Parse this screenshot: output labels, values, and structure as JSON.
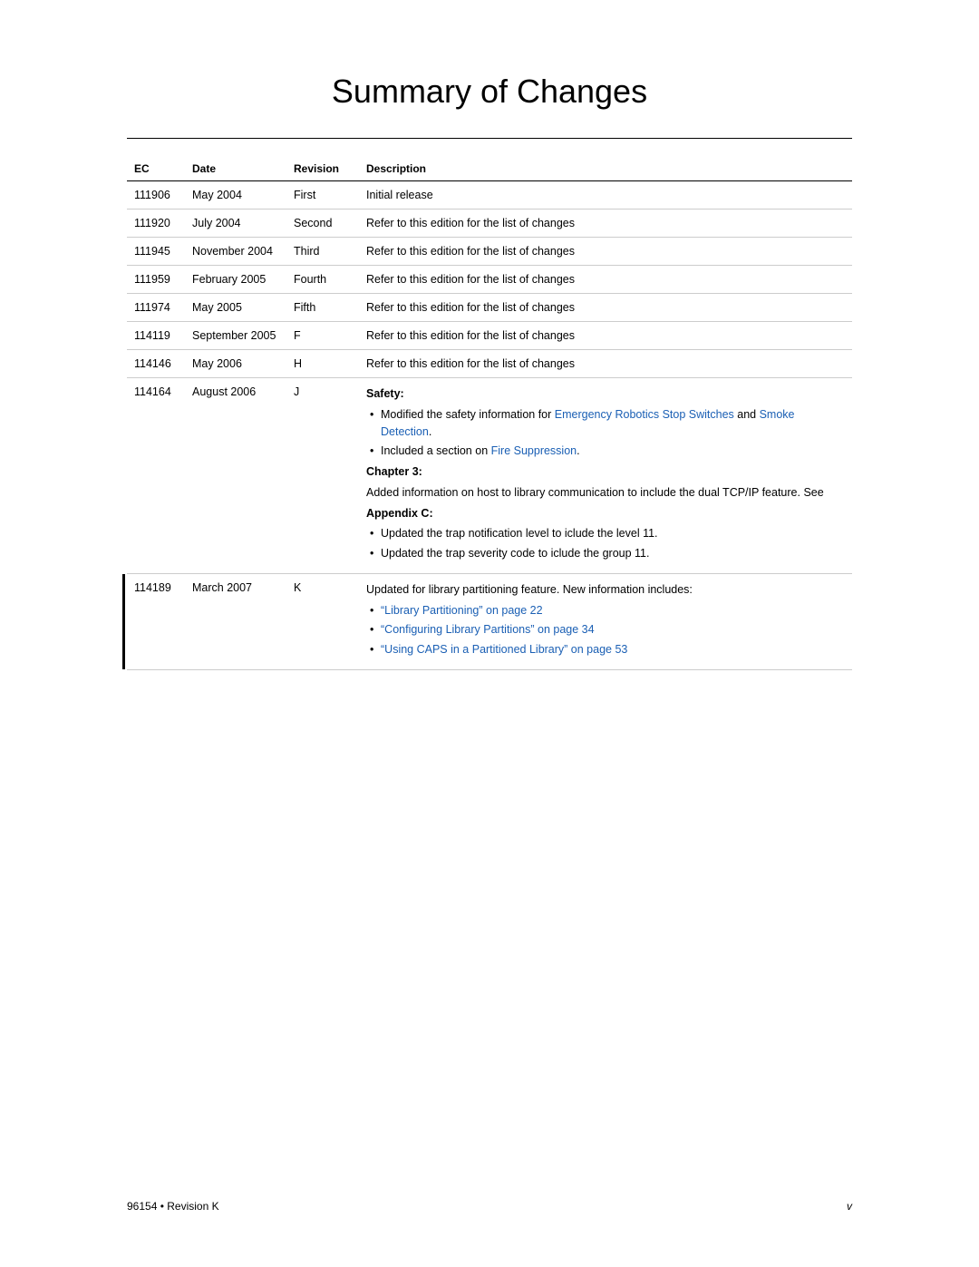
{
  "page": {
    "title": "Summary of Changes",
    "footer_left": "96154 • Revision K",
    "footer_right": "v"
  },
  "table": {
    "headers": {
      "ec": "EC",
      "date": "Date",
      "revision": "Revision",
      "description": "Description"
    },
    "rows": [
      {
        "ec": "111906",
        "date": "May 2004",
        "revision": "First",
        "description": "Initial release"
      },
      {
        "ec": "111920",
        "date": "July 2004",
        "revision": "Second",
        "description": "Refer to this edition for the list of changes"
      },
      {
        "ec": "111945",
        "date": "November 2004",
        "revision": "Third",
        "description": "Refer to this edition for the list of changes"
      },
      {
        "ec": "111959",
        "date": "February 2005",
        "revision": "Fourth",
        "description": "Refer to this edition for the list of changes"
      },
      {
        "ec": "111974",
        "date": "May 2005",
        "revision": "Fifth",
        "description": "Refer to this edition for the list of changes"
      },
      {
        "ec": "114119",
        "date": "September 2005",
        "revision": "F",
        "description": "Refer to this edition for the list of changes"
      },
      {
        "ec": "114146",
        "date": "May 2006",
        "revision": "H",
        "description": "Refer to this edition for the list of changes"
      }
    ],
    "row_114164": {
      "ec": "114164",
      "date": "August 2006",
      "revision": "J",
      "safety_label": "Safety:",
      "safety_modified_prefix": "Modified the safety information for ",
      "safety_link1": "Emergency Robotics Stop Switches",
      "safety_and": " and ",
      "safety_link2": "Smoke Detection",
      "safety_period": ".",
      "safety_included_prefix": "Included a section on ",
      "safety_link3": "Fire Suppression",
      "safety_included_suffix": ".",
      "chapter3_label": "Chapter 3:",
      "chapter3_text": "Added information on host to library communication to include the dual TCP/IP feature. See",
      "appendixc_label": "Appendix C:",
      "appendixc_item1": "Updated the trap notification level to iclude the level 11.",
      "appendixc_item2": "Updated the trap severity code to iclude the group 11."
    },
    "row_114189": {
      "ec": "114189",
      "date": "March 2007",
      "revision": "K",
      "desc_prefix": "Updated for library partitioning feature. New information includes:",
      "item1": "“Library Partitioning” on page 22",
      "item2": "“Configuring Library Partitions” on page 34",
      "item3": "“Using CAPS in a Partitioned Library” on page 53"
    }
  },
  "colors": {
    "link": "#1a5fb4",
    "text": "#000000",
    "divider": "#cccccc"
  }
}
